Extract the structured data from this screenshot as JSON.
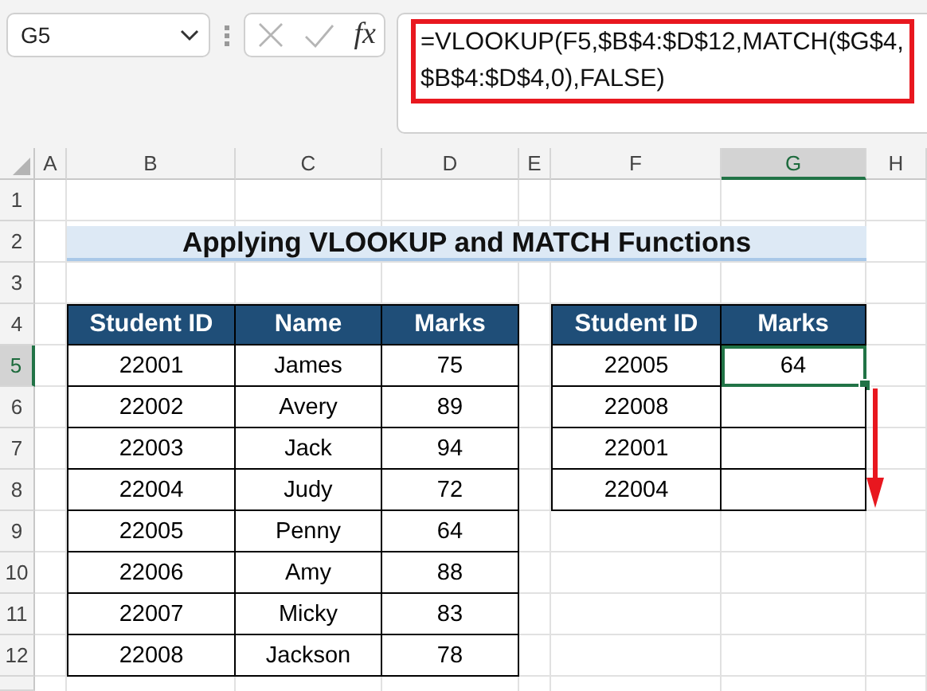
{
  "formula_bar": {
    "name_box": "G5",
    "fx": "fx",
    "formula_lines": [
      "=VLOOKUP(F5,$B$4:$D$12,MATCH($G$4,",
      "$B$4:$D$4,0),FALSE)"
    ]
  },
  "columns": [
    {
      "label": "A",
      "selected": false
    },
    {
      "label": "B",
      "selected": false
    },
    {
      "label": "C",
      "selected": false
    },
    {
      "label": "D",
      "selected": false
    },
    {
      "label": "E",
      "selected": false
    },
    {
      "label": "F",
      "selected": false
    },
    {
      "label": "G",
      "selected": true
    },
    {
      "label": "H",
      "selected": false
    }
  ],
  "rows": [
    {
      "label": "1",
      "selected": false
    },
    {
      "label": "2",
      "selected": false
    },
    {
      "label": "3",
      "selected": false
    },
    {
      "label": "4",
      "selected": false
    },
    {
      "label": "5",
      "selected": true
    },
    {
      "label": "6",
      "selected": false
    },
    {
      "label": "7",
      "selected": false
    },
    {
      "label": "8",
      "selected": false
    },
    {
      "label": "9",
      "selected": false
    },
    {
      "label": "10",
      "selected": false
    },
    {
      "label": "11",
      "selected": false
    },
    {
      "label": "12",
      "selected": false
    }
  ],
  "title": "Applying VLOOKUP and MATCH Functions",
  "data_table": {
    "columns": [
      "Student ID",
      "Name",
      "Marks"
    ],
    "rows": [
      [
        "22001",
        "James",
        "75"
      ],
      [
        "22002",
        "Avery",
        "89"
      ],
      [
        "22003",
        "Jack",
        "94"
      ],
      [
        "22004",
        "Judy",
        "72"
      ],
      [
        "22005",
        "Penny",
        "64"
      ],
      [
        "22006",
        "Amy",
        "88"
      ],
      [
        "22007",
        "Micky",
        "83"
      ],
      [
        "22008",
        "Jackson",
        "78"
      ]
    ]
  },
  "lookup_table": {
    "columns": [
      "Student ID",
      "Marks"
    ],
    "rows": [
      {
        "student_id": "22005",
        "marks": "64",
        "selected": true
      },
      {
        "student_id": "22008",
        "selected": false
      },
      {
        "student_id": "22001",
        "selected": false
      },
      {
        "student_id": "22004",
        "selected": false
      }
    ]
  }
}
